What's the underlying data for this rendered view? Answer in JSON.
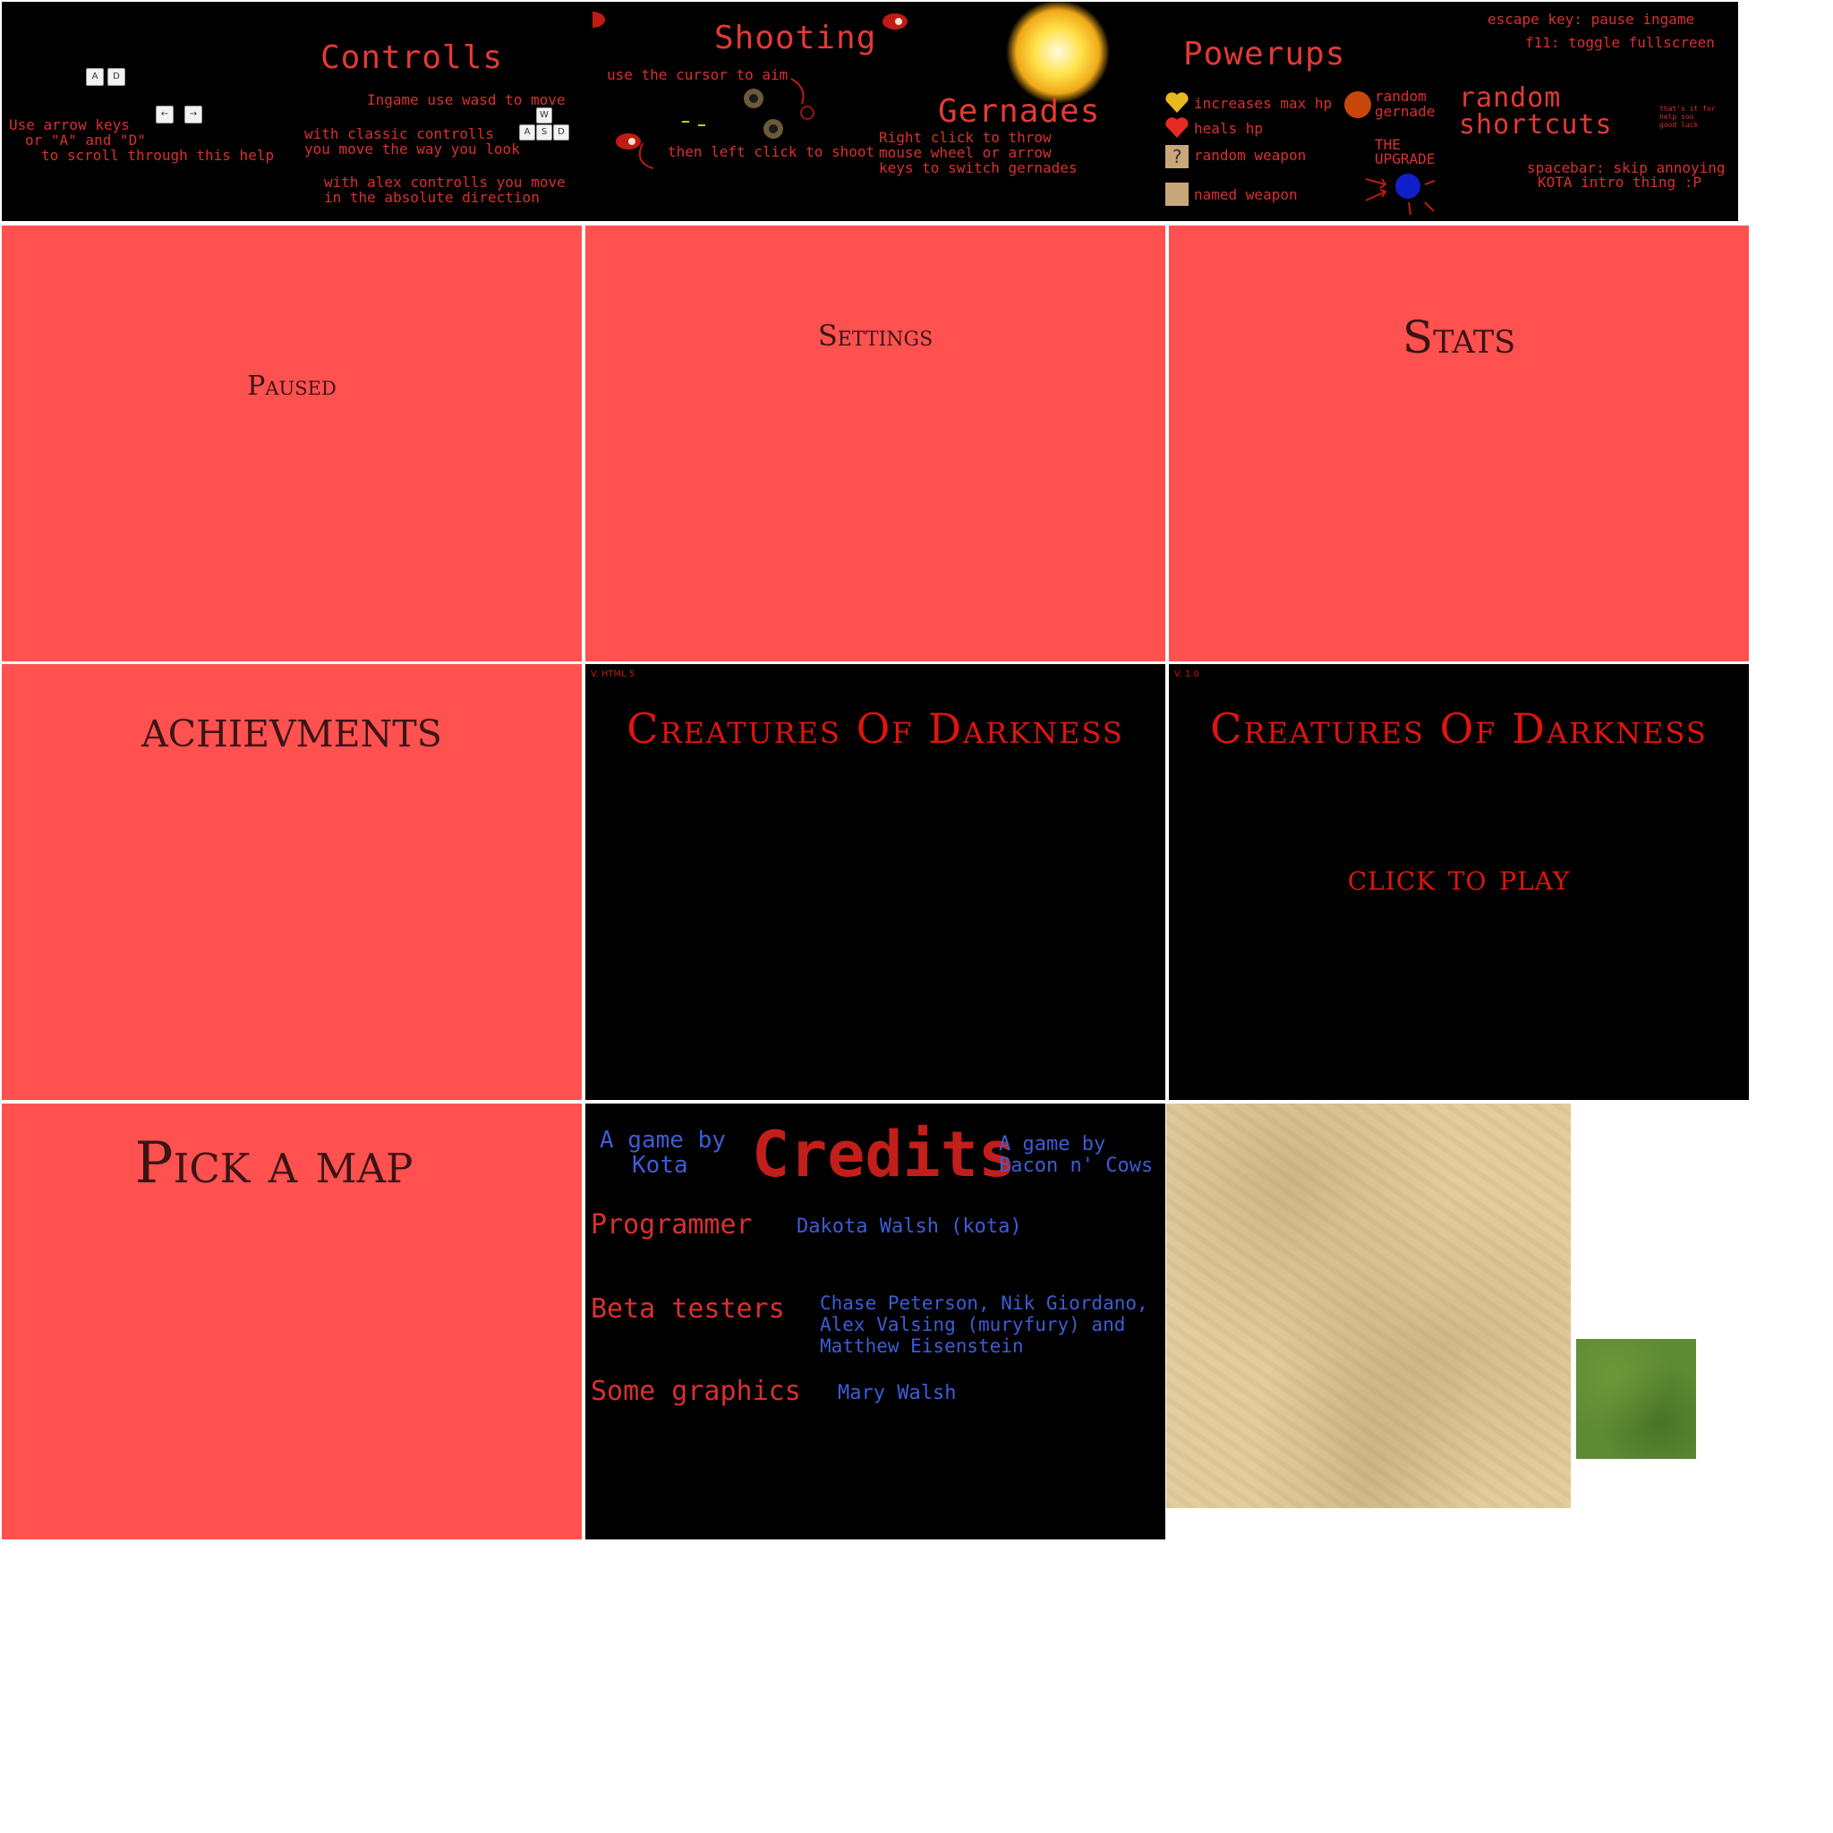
{
  "help": {
    "controls": {
      "title": "Controlls",
      "scroll_line1": "Use arrow keys",
      "scroll_line2": "or \"A\" and \"D\"",
      "scroll_line3": "to scroll through this help",
      "ingame": "Ingame use wasd to move",
      "classic_line1": "with classic controlls",
      "classic_line2": "you move the way you look",
      "alex_line1": "with alex controlls you move",
      "alex_line2": "in the absolute direction",
      "keys": [
        "A",
        "D",
        "←",
        "→",
        "W",
        "A",
        "S",
        "D"
      ]
    },
    "shooting": {
      "title": "Shooting",
      "aim": "use the cursor to aim",
      "shoot": "then left click to shoot"
    },
    "grenades": {
      "title": "Gernades",
      "line1": "Right click to throw",
      "line2": "mouse wheel or arrow",
      "line3": "keys to switch gernades"
    },
    "powerups": {
      "title": "Powerups",
      "max_hp": "increases max hp",
      "heals": "heals hp",
      "random_weapon": "random weapon",
      "named_weapon": "named weapon",
      "random_gernade_line1": "random",
      "random_gernade_line2": "gernade",
      "upgrade_line1": "THE",
      "upgrade_line2": "UPGRADE",
      "question_mark": "?"
    },
    "shortcuts": {
      "title_line1": "random",
      "title_line2": "shortcuts",
      "escape": "escape key: pause ingame",
      "f11": "f11: toggle fullscreen",
      "spacebar_line1": "spacebar: skip annoying",
      "spacebar_line2": "KOTA intro thing :P",
      "tiny_line1": "that's it for",
      "tiny_line2": "help soo",
      "tiny_line3": "good luck"
    }
  },
  "panels": {
    "paused": "Paused",
    "settings": "Settings",
    "stats": "Stats",
    "achievements": "achievments",
    "pick_map": "Pick a map",
    "title_html5": {
      "version": "V. HTML 5",
      "title": "Creatures Of Darkness"
    },
    "title_main": {
      "version": "V. 1.0",
      "title": "Creatures Of Darkness",
      "cta": "click to play"
    }
  },
  "credits": {
    "title": "Credits",
    "left_byline_1": "A game by",
    "left_byline_2": "Kota",
    "right_byline_1": "A game by",
    "right_byline_2": "Bacon n' Cows",
    "programmer_label": "Programmer",
    "programmer_name": "Dakota Walsh (kota)",
    "beta_label": "Beta testers",
    "beta_line1": "Chase Peterson, Nik Giordano,",
    "beta_line2": "Alex Valsing (muryfury) and",
    "beta_line3": "Matthew Eisenstein",
    "graphics_label": "Some graphics",
    "graphics_name": "Mary Walsh"
  },
  "colors": {
    "panel_red": "#ff5150",
    "title_red": "#e0140f",
    "help_text": "#d8312f",
    "credits_blue": "#3d5cd6"
  }
}
